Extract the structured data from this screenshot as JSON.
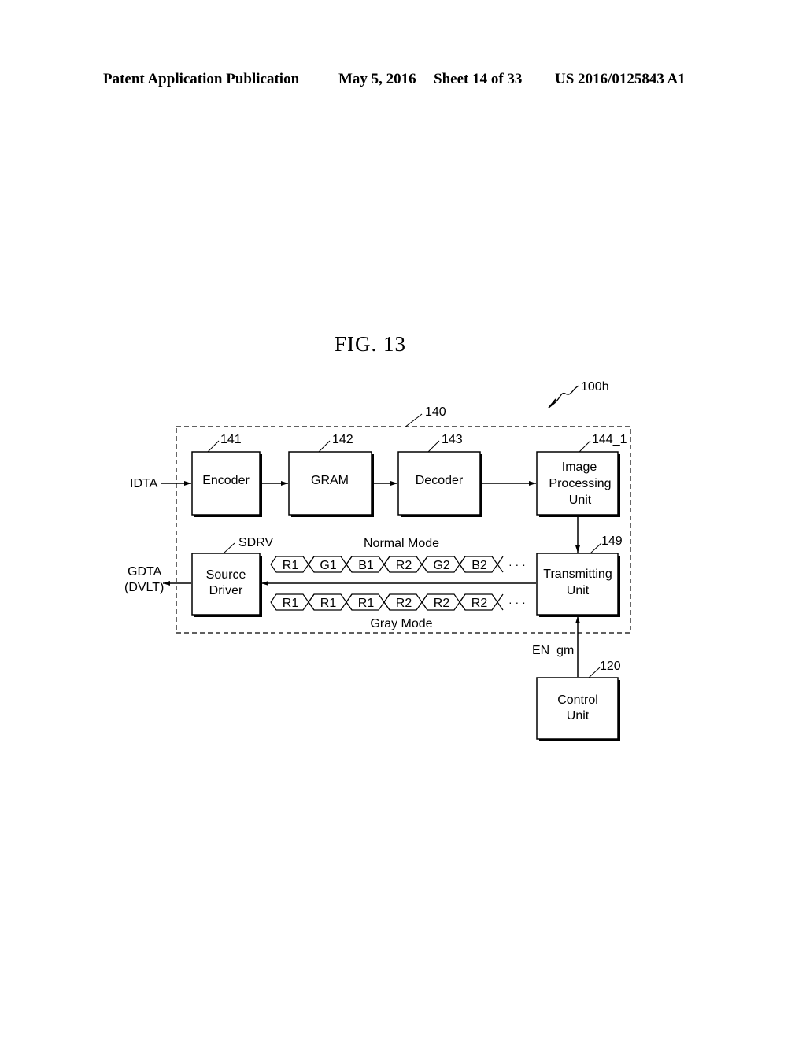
{
  "header": {
    "publication": "Patent Application Publication",
    "date": "May 5, 2016",
    "sheet": "Sheet 14 of 33",
    "patent_number": "US 2016/0125843 A1"
  },
  "figure": {
    "title": "FIG.  13",
    "system_ref": "100h",
    "group_ref": "140",
    "blocks": {
      "encoder": {
        "ref": "141",
        "label": "Encoder"
      },
      "gram": {
        "ref": "142",
        "label": "GRAM"
      },
      "decoder": {
        "ref": "143",
        "label": "Decoder"
      },
      "image_processing": {
        "ref": "144_1",
        "line1": "Image",
        "line2": "Processing",
        "line3": "Unit"
      },
      "transmitting": {
        "ref": "149",
        "line1": "Transmitting",
        "line2": "Unit"
      },
      "source_driver": {
        "ref": "SDRV",
        "line1": "Source",
        "line2": "Driver"
      },
      "control": {
        "ref": "120",
        "line1": "Control",
        "line2": "Unit"
      }
    },
    "signals": {
      "input": "IDTA",
      "output_line1": "GDTA",
      "output_line2": "(DVLT)",
      "enable": "EN_gm"
    },
    "normal_mode": {
      "label": "Normal Mode",
      "sequence": [
        "R1",
        "G1",
        "B1",
        "R2",
        "G2",
        "B2"
      ]
    },
    "gray_mode": {
      "label": "Gray Mode",
      "sequence": [
        "R1",
        "R1",
        "R1",
        "R2",
        "R2",
        "R2"
      ]
    },
    "ellipsis": "· · ·"
  }
}
